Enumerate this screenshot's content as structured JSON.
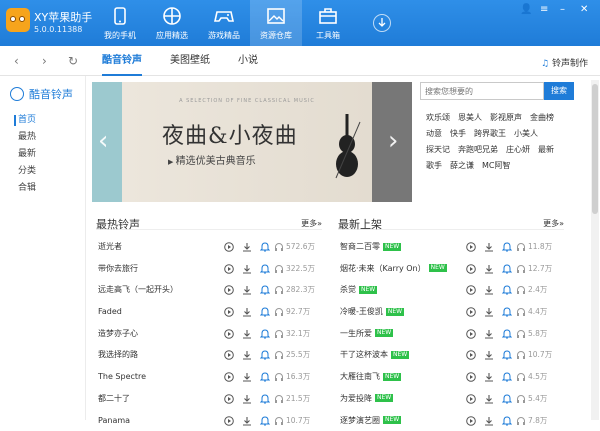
{
  "app": {
    "name": "XY苹果助手",
    "version": "5.0.0.11388"
  },
  "nav": [
    {
      "label": "我的手机",
      "icon": "phone-icon"
    },
    {
      "label": "应用精选",
      "icon": "apps-icon"
    },
    {
      "label": "游戏精品",
      "icon": "gamepad-icon"
    },
    {
      "label": "资源仓库",
      "icon": "image-icon"
    },
    {
      "label": "工具箱",
      "icon": "toolbox-icon"
    }
  ],
  "active_nav": "资源仓库",
  "tabs": [
    "酷音铃声",
    "美图壁纸",
    "小说"
  ],
  "ring_make": "铃声制作",
  "sidebar": {
    "title": "酷音铃声",
    "items": [
      "首页",
      "最热",
      "最新",
      "分类",
      "合辑"
    ]
  },
  "banner": {
    "small_text": "A SELECTION OF FINE CLASSICAL MUSIC",
    "title": "夜曲&小夜曲",
    "subtitle": "精选优美古典音乐"
  },
  "search": {
    "placeholder": "搜索您想要的",
    "button": "搜索"
  },
  "tags": [
    "欢乐颂",
    "恩美人",
    "影视原声",
    "金曲榜",
    "动意",
    "快手",
    "跨界歌王",
    "小美人",
    "探天记",
    "奔跑吧兄弟",
    "庄心妍",
    "最新",
    "歌手",
    "薛之谦",
    "MC阿智"
  ],
  "hot": {
    "title": "最热铃声",
    "more": "更多»",
    "rows": [
      {
        "name": "逝光者",
        "count": "572.6万"
      },
      {
        "name": "带你去旅行",
        "count": "322.5万"
      },
      {
        "name": "远走高飞（一起开头）",
        "count": "282.3万"
      },
      {
        "name": "Faded",
        "count": "92.7万"
      },
      {
        "name": "造梦亦子心",
        "count": "32.1万"
      },
      {
        "name": "我选择的路",
        "count": "25.5万"
      },
      {
        "name": "The Spectre",
        "count": "16.3万"
      },
      {
        "name": "都二十了",
        "count": "21.5万"
      },
      {
        "name": "Panama",
        "count": "10.7万"
      }
    ]
  },
  "new": {
    "title": "最新上架",
    "more": "更多»",
    "new_label": "NEW",
    "rows": [
      {
        "name": "智商二百零",
        "count": "11.8万"
      },
      {
        "name": "烟花·未来（Karry On）",
        "count": "12.7万"
      },
      {
        "name": "杀觉",
        "count": "2.4万"
      },
      {
        "name": "冷暖-王俊凯",
        "count": "4.4万"
      },
      {
        "name": "一生所爱",
        "count": "5.8万"
      },
      {
        "name": "干了这杯波本",
        "count": "10.7万"
      },
      {
        "name": "大雁往南飞",
        "count": "4.5万"
      },
      {
        "name": "为爱投降",
        "count": "5.4万"
      },
      {
        "name": "逐梦演艺圈",
        "count": "7.8万"
      }
    ]
  }
}
